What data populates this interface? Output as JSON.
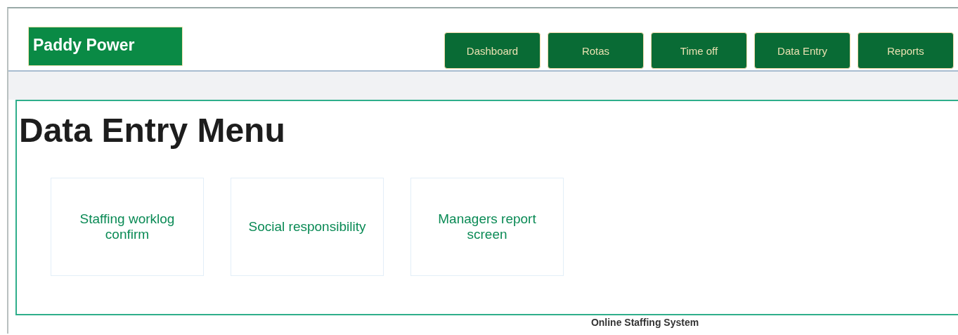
{
  "header": {
    "logo": "Paddy Power",
    "nav": [
      {
        "label": "Dashboard",
        "selected": false
      },
      {
        "label": "Rotas",
        "selected": false
      },
      {
        "label": "Time off",
        "selected": false
      },
      {
        "label": "Data Entry",
        "selected": false
      },
      {
        "label": "Reports",
        "selected": false
      }
    ]
  },
  "page": {
    "title": "Data Entry Menu",
    "tiles": [
      {
        "label": "Staffing worklog confirm"
      },
      {
        "label": "Social responsibility"
      },
      {
        "label": "Managers report screen"
      }
    ]
  },
  "footer": {
    "text": "Online Staffing System"
  }
}
